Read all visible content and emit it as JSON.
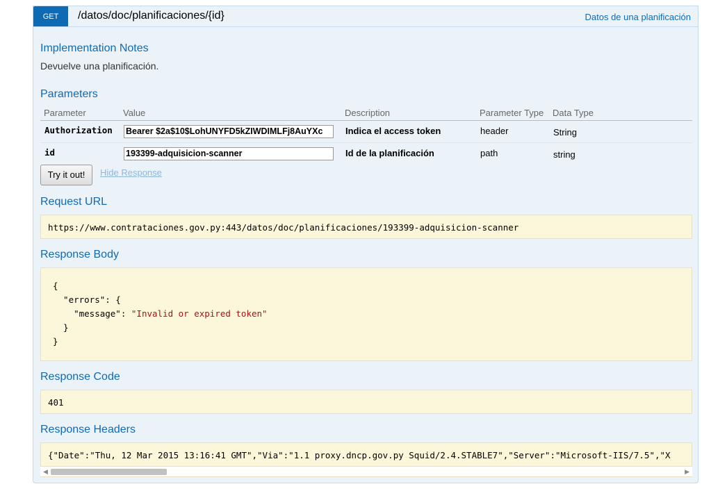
{
  "operation": {
    "method": "GET",
    "path": "/datos/doc/planificaciones/{id}",
    "summary": "Datos de una planificación"
  },
  "implementation_notes": {
    "heading": "Implementation Notes",
    "text": "Devuelve una planificación."
  },
  "parameters": {
    "heading": "Parameters",
    "columns": [
      "Parameter",
      "Value",
      "Description",
      "Parameter Type",
      "Data Type"
    ],
    "rows": [
      {
        "name": "Authorization",
        "value": "Bearer $2a$10$LohUNYFD5kZIWDIMLFj8AuYXc",
        "description": "Indica el access token",
        "param_type": "header",
        "data_type": "String"
      },
      {
        "name": "id",
        "value": "193399-adquisicion-scanner",
        "description": "Id de la planificación",
        "param_type": "path",
        "data_type": "string"
      }
    ]
  },
  "actions": {
    "try_label": "Try it out!",
    "hide_label": "Hide Response"
  },
  "request_url": {
    "heading": "Request URL",
    "value": "https://www.contrataciones.gov.py:443/datos/doc/planificaciones/193399-adquisicion-scanner"
  },
  "response_body": {
    "heading": "Response Body",
    "lines": [
      "{",
      "  \"errors\": {",
      "    \"message\": ",
      "  }",
      "}"
    ],
    "message_value": "\"Invalid or expired token\""
  },
  "response_code": {
    "heading": "Response Code",
    "value": "401"
  },
  "response_headers": {
    "heading": "Response Headers",
    "value": "{\"Date\":\"Thu, 12 Mar 2015 13:16:41 GMT\",\"Via\":\"1.1 proxy.dncp.gov.py Squid/2.4.STABLE7\",\"Server\":\"Microsoft-IIS/7.5\",\"X"
  }
}
